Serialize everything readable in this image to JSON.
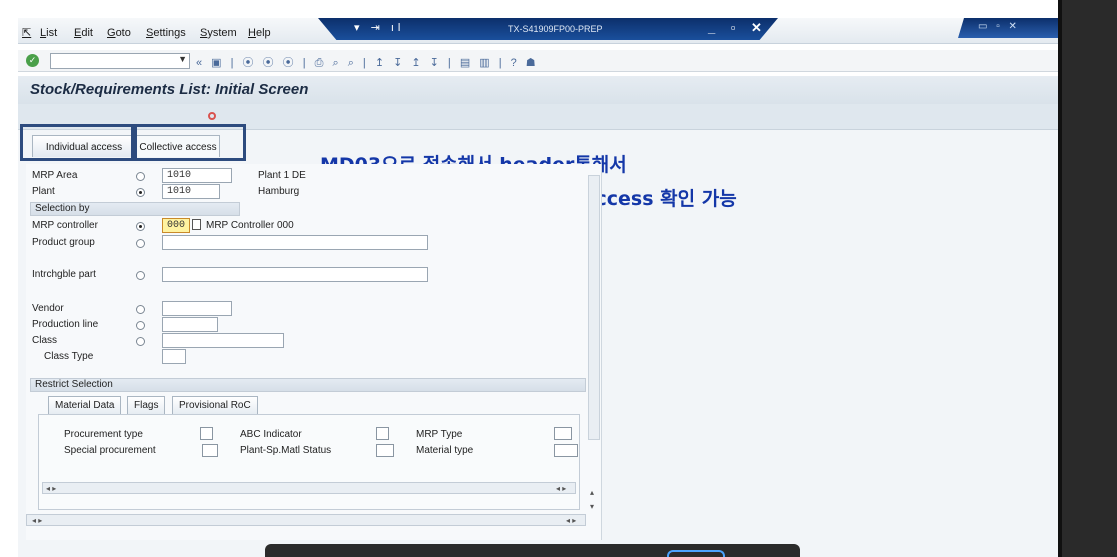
{
  "menu": {
    "items": [
      "List",
      "Edit",
      "Goto",
      "Settings",
      "System",
      "Help"
    ],
    "system_title": "TX-S41909FP00-PREP",
    "title_icons": "▾ ⇥ ıl",
    "window_controls": "_ ▫ ✕",
    "right_tab_buttons": "▭ ▫ ✕"
  },
  "toolbar": {
    "command_value": "",
    "icons": "« ▣ | ⦿ ⦿ ⦿ | ⎙ ⌕ ⌕ | ↥ ↧ ↥ ↧ | ▤ ▥ | ? ☗"
  },
  "page": {
    "title": "Stock/Requirements List: Initial Screen"
  },
  "tabs": {
    "individual": "Individual access",
    "collective": "Collective access"
  },
  "annotation": {
    "line1": "MD03으로 접속해서 header통해서",
    "line2": "individual 혹은 collective access 확인 가능"
  },
  "form": {
    "mrp_area_label": "MRP Area",
    "mrp_area_value": "1010",
    "mrp_area_desc": "Plant 1 DE",
    "plant_label": "Plant",
    "plant_value": "1010",
    "plant_desc": "Hamburg",
    "selection_by": "Selection by",
    "mrp_controller_label": "MRP controller",
    "mrp_controller_value": "000",
    "mrp_controller_desc": "MRP Controller 000",
    "product_group_label": "Product group",
    "intrchgble_label": "Intrchgble part",
    "vendor_label": "Vendor",
    "production_line_label": "Production line",
    "class_label": "Class",
    "class_type_label": "Class Type",
    "restrict_selection": "Restrict Selection",
    "subtabs": [
      "Material Data",
      "Flags",
      "Provisional RoC"
    ],
    "procurement_type": "Procurement type",
    "special_procurement": "Special procurement",
    "abc_indicator": "ABC Indicator",
    "plant_sp_status": "Plant-Sp.Matl Status",
    "mrp_type": "MRP Type",
    "material_type": "Material type"
  },
  "colors": {
    "title_band": "#1a4f9c",
    "annotation": "#1437a8",
    "highlight": "#2d4b7e"
  }
}
